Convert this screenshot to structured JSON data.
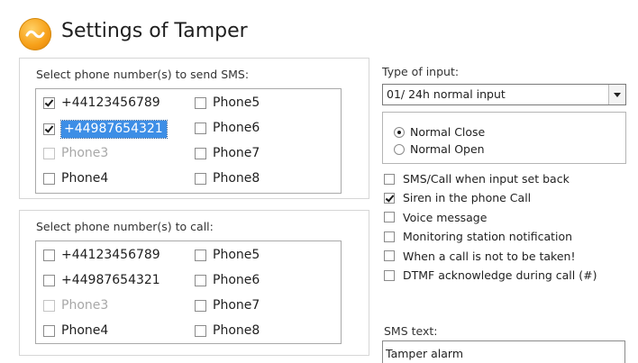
{
  "header": {
    "title": "Settings of Tamper",
    "icon": "sync-logo-icon"
  },
  "sms_section": {
    "label": "Select phone number(s) to send SMS:",
    "items": [
      {
        "label": "+44123456789",
        "checked": true,
        "disabled": false,
        "selected": false
      },
      {
        "label": "Phone5",
        "checked": false,
        "disabled": false,
        "selected": false
      },
      {
        "label": "+44987654321",
        "checked": true,
        "disabled": false,
        "selected": true
      },
      {
        "label": "Phone6",
        "checked": false,
        "disabled": false,
        "selected": false
      },
      {
        "label": "Phone3",
        "checked": false,
        "disabled": true,
        "selected": false
      },
      {
        "label": "Phone7",
        "checked": false,
        "disabled": false,
        "selected": false
      },
      {
        "label": "Phone4",
        "checked": false,
        "disabled": false,
        "selected": false
      },
      {
        "label": "Phone8",
        "checked": false,
        "disabled": false,
        "selected": false
      }
    ]
  },
  "call_section": {
    "label": "Select phone number(s) to call:",
    "items": [
      {
        "label": "+44123456789",
        "checked": false,
        "disabled": false
      },
      {
        "label": "Phone5",
        "checked": false,
        "disabled": false
      },
      {
        "label": "+44987654321",
        "checked": false,
        "disabled": false
      },
      {
        "label": "Phone6",
        "checked": false,
        "disabled": false
      },
      {
        "label": "Phone3",
        "checked": false,
        "disabled": true
      },
      {
        "label": "Phone7",
        "checked": false,
        "disabled": false
      },
      {
        "label": "Phone4",
        "checked": false,
        "disabled": false
      },
      {
        "label": "Phone8",
        "checked": false,
        "disabled": false
      }
    ]
  },
  "input_type": {
    "label": "Type of input:",
    "selected": "01/ 24h normal input",
    "radios": [
      {
        "label": "Normal Close",
        "checked": true
      },
      {
        "label": "Normal Open",
        "checked": false
      }
    ]
  },
  "options": [
    {
      "label": "SMS/Call when input set back",
      "checked": false
    },
    {
      "label": "Siren in the phone Call",
      "checked": true
    },
    {
      "label": "Voice message",
      "checked": false
    },
    {
      "label": "Monitoring station notification",
      "checked": false
    },
    {
      "label": "When a call is not to be taken!",
      "checked": false
    },
    {
      "label": "DTMF acknowledge during call (#)",
      "checked": false
    }
  ],
  "sms_text": {
    "label": "SMS text:",
    "value": "Tamper alarm"
  },
  "colors": {
    "accent": "#f7a11a",
    "selection": "#3d8ee6"
  }
}
